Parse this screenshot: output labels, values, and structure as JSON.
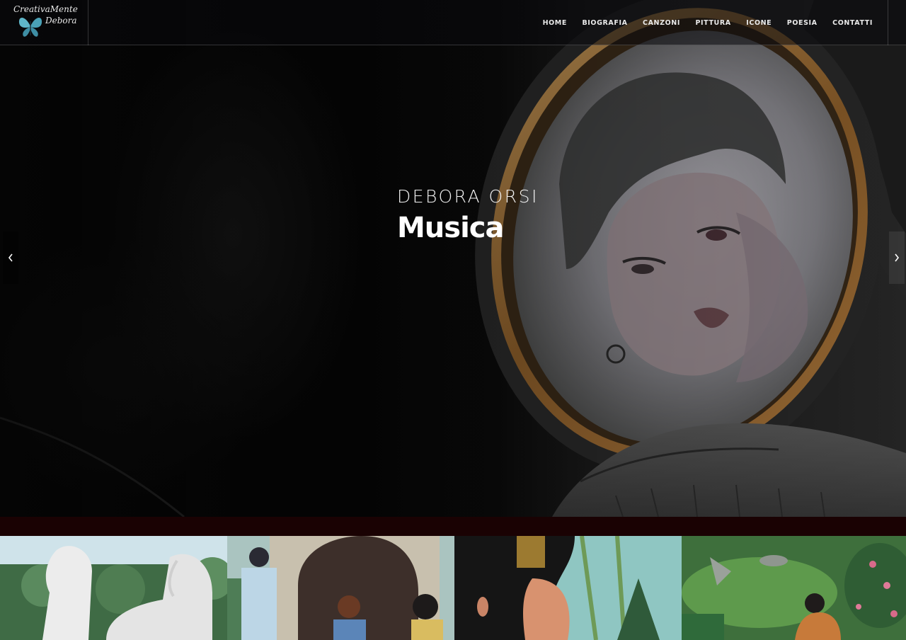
{
  "logo": {
    "line1": "CreativaMente",
    "line2": "Debora"
  },
  "nav": {
    "items": [
      "HOME",
      "BIOGRAFIA",
      "CANZONI",
      "PITTURA",
      "ICONE",
      "POESIA",
      "CONTATTI"
    ]
  },
  "hero": {
    "subtitle": "DEBORA ORSI",
    "title": "Musica",
    "prev_icon": "chevron-left-icon",
    "next_icon": "chevron-right-icon"
  },
  "colors": {
    "strip": "#1a0203",
    "frame_gold": "#a7743a",
    "butterfly": "#5fb6c9"
  },
  "gallery": {
    "items": [
      {
        "subject": "white horses painting"
      },
      {
        "subject": "women by stone arch painting"
      },
      {
        "subject": "japanese woman portrait painting"
      },
      {
        "subject": "woman in garden painting"
      }
    ]
  }
}
